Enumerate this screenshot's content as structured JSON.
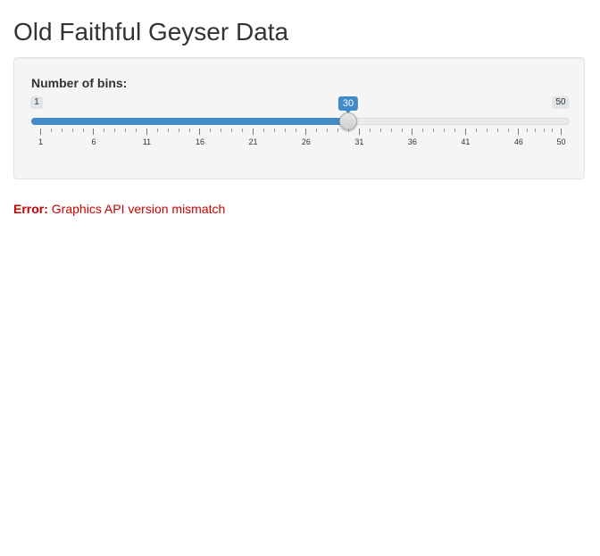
{
  "app": {
    "title": "Old Faithful Geyser Data"
  },
  "sidebar": {
    "bins_label": "Number of bins:",
    "slider": {
      "min": 1,
      "max": 50,
      "value": 30,
      "min_text": "1",
      "max_text": "50",
      "value_text": "30",
      "tick_labels": [
        "1",
        "6",
        "11",
        "16",
        "21",
        "26",
        "31",
        "36",
        "41",
        "46",
        "50"
      ],
      "accent_color": "#428bca"
    }
  },
  "main": {
    "error": {
      "prefix": "Error:",
      "message": "Graphics API version mismatch",
      "color": "#cc0000"
    }
  }
}
